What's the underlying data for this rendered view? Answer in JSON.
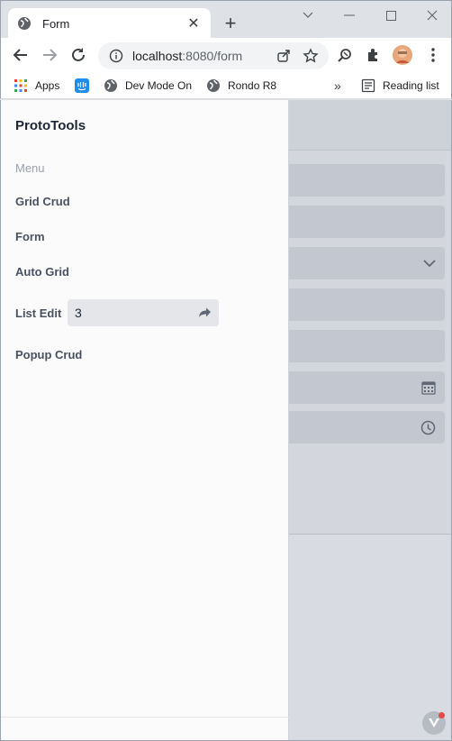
{
  "browser": {
    "tab": {
      "title": "Form"
    },
    "url": {
      "host": "localhost",
      "rest": ":8080/form"
    },
    "bookmarks": [
      {
        "label": "Apps"
      },
      {
        "label": "Dev Mode On"
      },
      {
        "label": "Rondo R8"
      }
    ],
    "reading_list": "Reading list",
    "overflow": "»"
  },
  "drawer": {
    "brand": "ProtoTools",
    "menu_label": "Menu",
    "items": {
      "grid_crud": "Grid Crud",
      "form": "Form",
      "auto_grid": "Auto Grid",
      "list_edit": "List Edit",
      "popup_crud": "Popup Crud"
    },
    "list_edit_value": "3"
  },
  "colors": {
    "accent": "#1a73e8",
    "drawer_bg": "#fbfbfc"
  }
}
